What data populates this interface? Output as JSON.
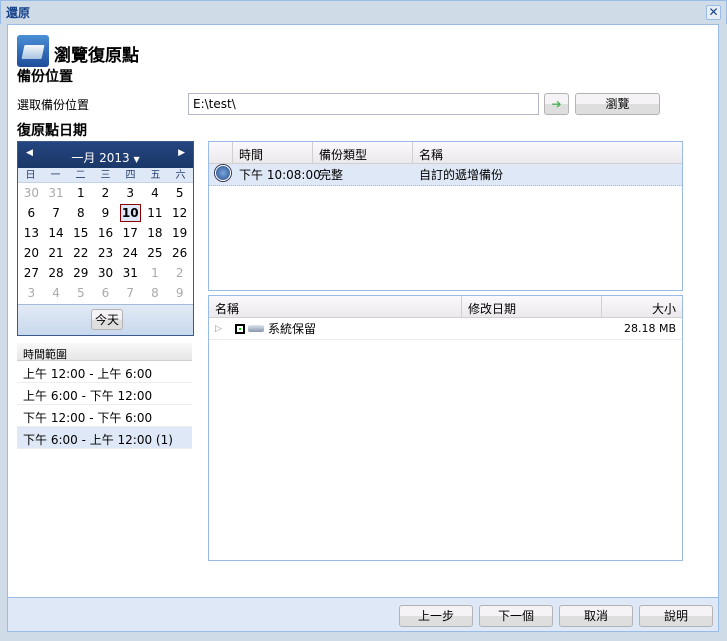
{
  "window": {
    "title": "還原",
    "close_icon": "close-icon"
  },
  "header": {
    "title": "瀏覽復原點",
    "icon": "folder-open-icon"
  },
  "backup_location": {
    "heading": "備份位置",
    "label": "選取備份位置",
    "value": "E:\\test\\",
    "go_icon": "arrow-right-icon",
    "browse_label": "瀏覽"
  },
  "recovery_date": {
    "heading": "復原點日期"
  },
  "calendar": {
    "month_label": "一月 2013",
    "prev_icon": "triangle-left-icon",
    "next_icon": "triangle-right-icon",
    "weekdays": [
      "日",
      "一",
      "二",
      "三",
      "四",
      "五",
      "六"
    ],
    "days": [
      [
        "30",
        "o"
      ],
      [
        "31",
        "o"
      ],
      [
        "1",
        ""
      ],
      [
        "2",
        ""
      ],
      [
        "3",
        ""
      ],
      [
        "4",
        ""
      ],
      [
        "5",
        ""
      ],
      [
        "6",
        ""
      ],
      [
        "7",
        ""
      ],
      [
        "8",
        ""
      ],
      [
        "9",
        ""
      ],
      [
        "10",
        "sel"
      ],
      [
        "11",
        ""
      ],
      [
        "12",
        ""
      ],
      [
        "13",
        ""
      ],
      [
        "14",
        ""
      ],
      [
        "15",
        ""
      ],
      [
        "16",
        ""
      ],
      [
        "17",
        ""
      ],
      [
        "18",
        ""
      ],
      [
        "19",
        ""
      ],
      [
        "20",
        ""
      ],
      [
        "21",
        ""
      ],
      [
        "22",
        ""
      ],
      [
        "23",
        ""
      ],
      [
        "24",
        ""
      ],
      [
        "25",
        ""
      ],
      [
        "26",
        ""
      ],
      [
        "27",
        ""
      ],
      [
        "28",
        ""
      ],
      [
        "29",
        ""
      ],
      [
        "30",
        ""
      ],
      [
        "31",
        ""
      ],
      [
        "1",
        "o"
      ],
      [
        "2",
        "o"
      ],
      [
        "3",
        "o"
      ],
      [
        "4",
        "o"
      ],
      [
        "5",
        "o"
      ],
      [
        "6",
        "o"
      ],
      [
        "7",
        "o"
      ],
      [
        "8",
        "o"
      ],
      [
        "9",
        "o"
      ]
    ],
    "today_label": "今天"
  },
  "time_range": {
    "header": "時間範圍",
    "items": [
      "上午 12:00 - 上午 6:00",
      "上午 6:00 - 下午 12:00",
      "下午 12:00 - 下午 6:00",
      "下午 6:00 - 上午 12:00 (1)"
    ],
    "selected": 3
  },
  "recovery_points": {
    "columns": [
      "時間",
      "備份類型",
      "名稱"
    ],
    "rows": [
      {
        "time": "下午 10:08:00",
        "type": "完整",
        "name": "自訂的遞增備份"
      }
    ]
  },
  "files": {
    "columns": [
      "名稱",
      "修改日期",
      "大小"
    ],
    "rows": [
      {
        "name": "系統保留",
        "date": "",
        "size": "28.18 MB"
      }
    ]
  },
  "footer": {
    "back": "上一步",
    "next": "下一個",
    "cancel": "取消",
    "help": "說明"
  }
}
